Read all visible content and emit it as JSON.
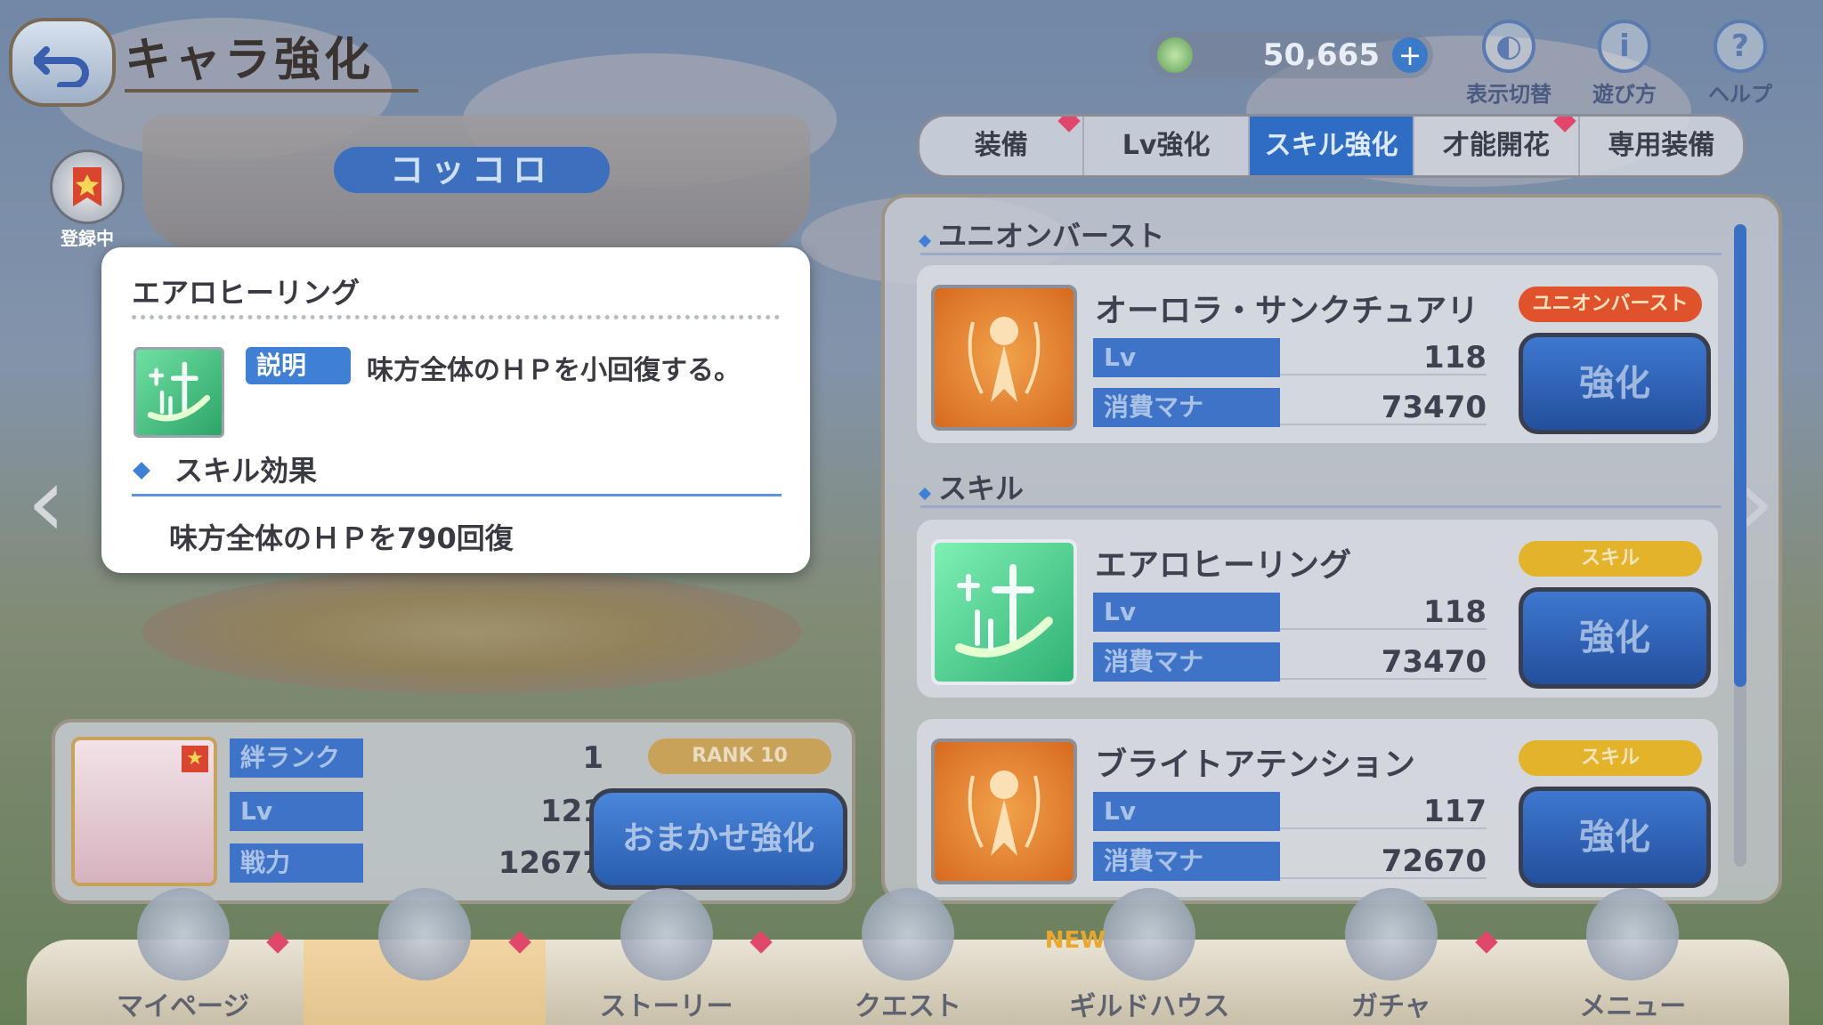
{
  "header": {
    "title": "キャラ強化",
    "currency_value": "50,665",
    "buttons": [
      {
        "label": "表示切替",
        "icon": "toggle-display-icon"
      },
      {
        "label": "遊び方",
        "icon": "info-icon"
      },
      {
        "label": "ヘルプ",
        "icon": "help-icon"
      }
    ]
  },
  "tabs": [
    {
      "label": "装備",
      "active": false,
      "badge": true
    },
    {
      "label": "Lv強化",
      "active": false,
      "badge": false
    },
    {
      "label": "スキル強化",
      "active": true,
      "badge": false
    },
    {
      "label": "才能開花",
      "active": false,
      "badge": true
    },
    {
      "label": "専用装備",
      "active": false,
      "badge": false
    }
  ],
  "character": {
    "name": "コッコロ",
    "fav_label": "登録中"
  },
  "popup": {
    "title": "エアロヒーリング",
    "desc_badge": "説明",
    "desc_text": "味方全体のＨＰを小回復する。",
    "effect_heading": "スキル効果",
    "effect_text": "味方全体のＨＰを790回復"
  },
  "panel": {
    "union_burst_heading": "ユニオンバースト",
    "skill_heading": "スキル",
    "cards": [
      {
        "name": "オーロラ・サンクチュアリ",
        "type_label": "ユニオンバースト",
        "lv_label": "Lv",
        "lv": "118",
        "mana_label": "消費マナ",
        "mana": "73470",
        "button": "強化"
      },
      {
        "name": "エアロヒーリング",
        "type_label": "スキル",
        "lv_label": "Lv",
        "lv": "118",
        "mana_label": "消費マナ",
        "mana": "73470",
        "button": "強化"
      },
      {
        "name": "ブライトアテンション",
        "type_label": "スキル",
        "lv_label": "Lv",
        "lv": "117",
        "mana_label": "消費マナ",
        "mana": "72670",
        "button": "強化"
      }
    ]
  },
  "char_panel": {
    "bond_label": "絆ランク",
    "bond_value": "1",
    "lv_label": "Lv",
    "lv_value": "121",
    "power_label": "戦力",
    "power_value": "12677",
    "rank_badge": "RANK 10",
    "auto_button": "おまかせ強化"
  },
  "nav": [
    {
      "label": "マイページ",
      "active": false,
      "badge": true,
      "new": false
    },
    {
      "label": "",
      "active": true,
      "badge": true,
      "new": false
    },
    {
      "label": "ストーリー",
      "active": false,
      "badge": true,
      "new": false
    },
    {
      "label": "クエスト",
      "active": false,
      "badge": false,
      "new": false
    },
    {
      "label": "ギルドハウス",
      "active": false,
      "badge": false,
      "new": true,
      "new_label": "NEW"
    },
    {
      "label": "ガチャ",
      "active": false,
      "badge": true,
      "new": false
    },
    {
      "label": "メニュー",
      "active": false,
      "badge": false,
      "new": false
    }
  ]
}
